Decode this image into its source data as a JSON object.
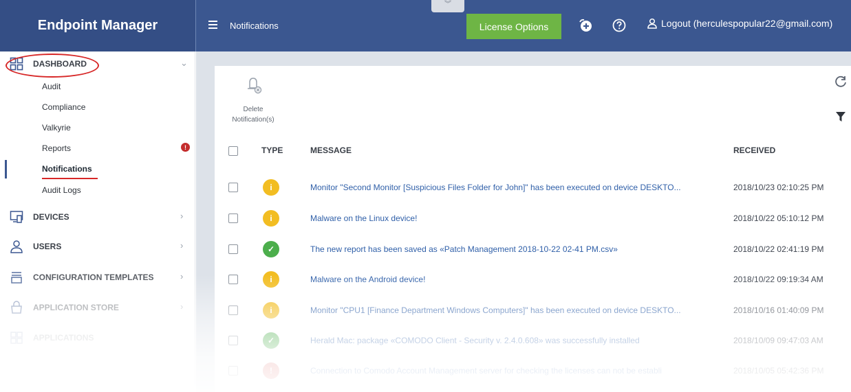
{
  "app": {
    "title": "Endpoint Manager",
    "page": "Notifications"
  },
  "header": {
    "license_label": "License Options",
    "logout_label": "Logout (herculespopular22@gmail.com)"
  },
  "sidebar": {
    "dashboard": {
      "label": "DASHBOARD",
      "items": [
        {
          "label": "Audit"
        },
        {
          "label": "Compliance"
        },
        {
          "label": "Valkyrie"
        },
        {
          "label": "Reports",
          "badge": "!"
        },
        {
          "label": "Notifications",
          "active": true
        },
        {
          "label": "Audit Logs"
        }
      ]
    },
    "sections": [
      {
        "label": "DEVICES",
        "icon": "devices-icon"
      },
      {
        "label": "USERS",
        "icon": "user-icon"
      },
      {
        "label": "CONFIGURATION TEMPLATES",
        "icon": "template-icon"
      },
      {
        "label": "APPLICATION STORE",
        "icon": "store-icon"
      },
      {
        "label": "APPLICATIONS",
        "icon": "apps-icon"
      }
    ]
  },
  "toolbar": {
    "delete_label_1": "Delete",
    "delete_label_2": "Notification(s)"
  },
  "table": {
    "columns": [
      "TYPE",
      "MESSAGE",
      "RECEIVED"
    ],
    "rows": [
      {
        "type": "info",
        "message": "Monitor \"Second Monitor [Suspicious Files Folder for John]\" has been executed on device DESKTO...",
        "received": "2018/10/23 02:10:25 PM"
      },
      {
        "type": "info",
        "message": "Malware on the Linux device!",
        "received": "2018/10/22 05:10:12 PM"
      },
      {
        "type": "success",
        "message": "The new report has been saved as «Patch Management 2018-10-22 02-41 PM.csv»",
        "received": "2018/10/22 02:41:19 PM"
      },
      {
        "type": "info",
        "message": "Malware on the Android device!",
        "received": "2018/10/22 09:19:34 AM"
      },
      {
        "type": "info",
        "message": "Monitor \"CPU1 [Finance Department Windows Computers]\" has been executed on device DESKTO...",
        "received": "2018/10/16 01:40:09 PM"
      },
      {
        "type": "success",
        "message": "Herald Mac: package «COMODO Client - Security v. 2.4.0.608» was successfully installed",
        "received": "2018/10/09 09:47:03 AM"
      },
      {
        "type": "error",
        "message": "Connection to Comodo Account Management server for checking the licenses can not be establi",
        "received": "2018/10/05 05:42:36 PM"
      }
    ]
  },
  "colors": {
    "topbar": "#3b5790",
    "brand": "#344e85",
    "license": "#6eb545",
    "info": "#f2bd22",
    "success": "#4cae4c",
    "error": "#d9534f",
    "annotation": "#d72727"
  }
}
